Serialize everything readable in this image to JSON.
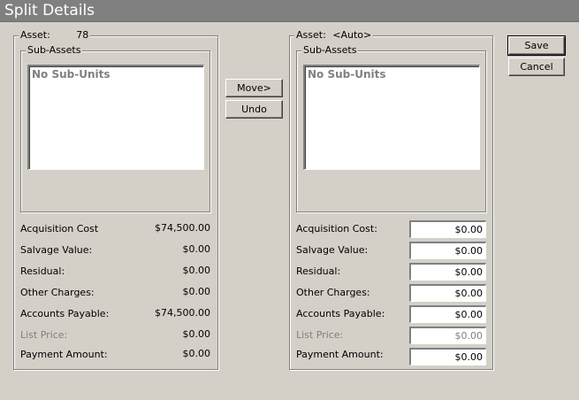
{
  "window": {
    "title": "Split Details"
  },
  "left": {
    "asset_label": "Asset:",
    "asset_value": "78",
    "subassets_label": "Sub-Assets",
    "list_empty": "No Sub-Units",
    "rows": [
      {
        "label": "Acquisition Cost",
        "value": "$74,500.00"
      },
      {
        "label": "Salvage Value:",
        "value": "$0.00"
      },
      {
        "label": "Residual:",
        "value": "$0.00"
      },
      {
        "label": "Other Charges:",
        "value": "$0.00"
      },
      {
        "label": "Accounts Payable:",
        "value": "$74,500.00"
      },
      {
        "label": "List Price:",
        "value": "$0.00"
      },
      {
        "label": "Payment Amount:",
        "value": "$0.00"
      }
    ]
  },
  "middle": {
    "move_label": "Move>",
    "undo_label": "Undo"
  },
  "right": {
    "asset_label": "Asset:",
    "asset_value": "<Auto>",
    "subassets_label": "Sub-Assets",
    "list_empty": "No Sub-Units",
    "rows": [
      {
        "label": "Acquisition Cost:",
        "value": "$0.00"
      },
      {
        "label": "Salvage Value:",
        "value": "$0.00"
      },
      {
        "label": "Residual:",
        "value": "$0.00"
      },
      {
        "label": "Other Charges:",
        "value": "$0.00"
      },
      {
        "label": "Accounts Payable:",
        "value": "$0.00"
      },
      {
        "label": "List Price:",
        "value": "$0.00"
      },
      {
        "label": "Payment Amount:",
        "value": "$0.00"
      }
    ]
  },
  "actions": {
    "save_label": "Save",
    "cancel_label": "Cancel"
  }
}
